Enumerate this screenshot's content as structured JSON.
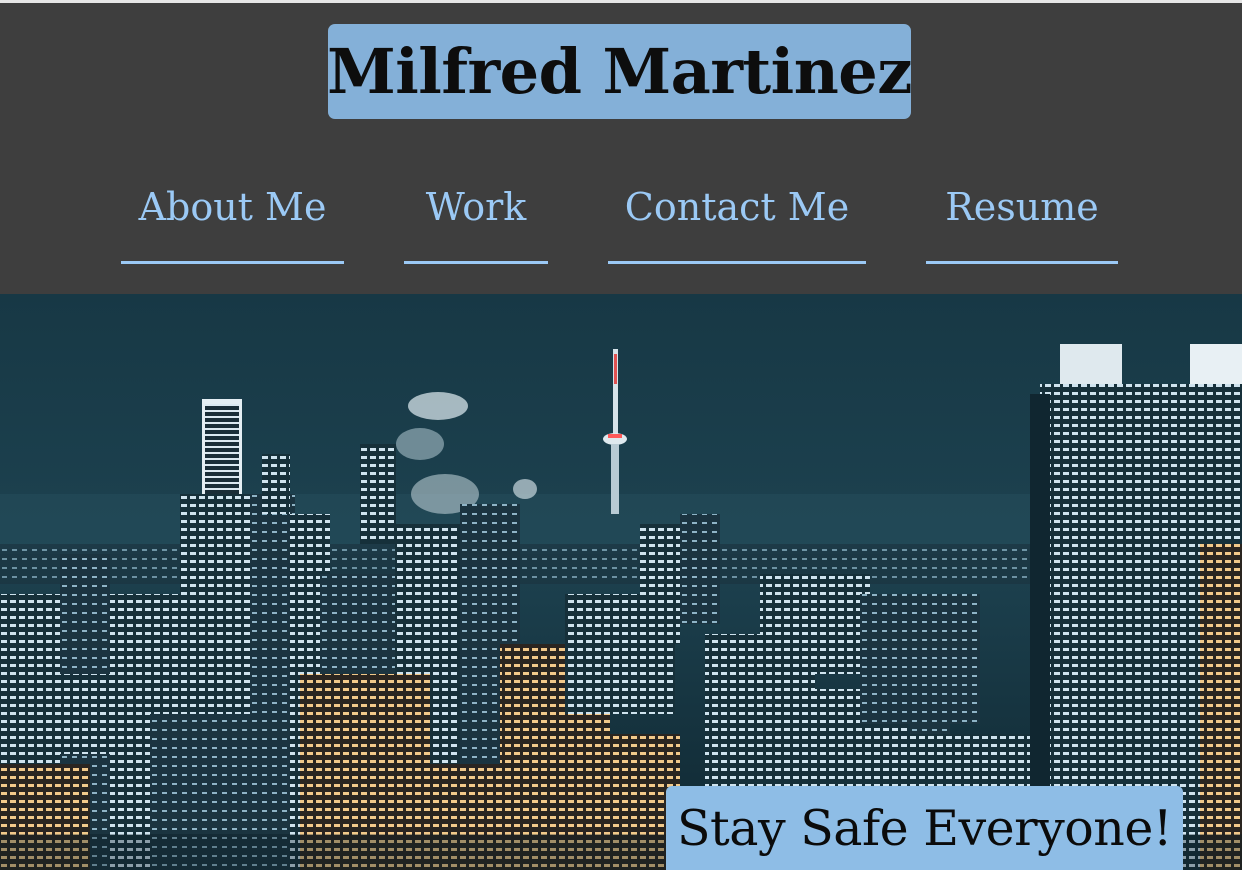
{
  "header": {
    "site_title": "Milfred Martinez"
  },
  "nav": {
    "items": [
      {
        "label": "About Me"
      },
      {
        "label": "Work"
      },
      {
        "label": "Contact Me"
      },
      {
        "label": "Resume"
      }
    ]
  },
  "hero": {
    "image": "night-city-skyline",
    "banner_text": "Stay Safe Everyone!"
  },
  "colors": {
    "header_bg": "#3e3e3e",
    "title_bg": "#84b0d8",
    "nav_link": "#9bc9f5",
    "banner_bg": "#8ebde6"
  }
}
